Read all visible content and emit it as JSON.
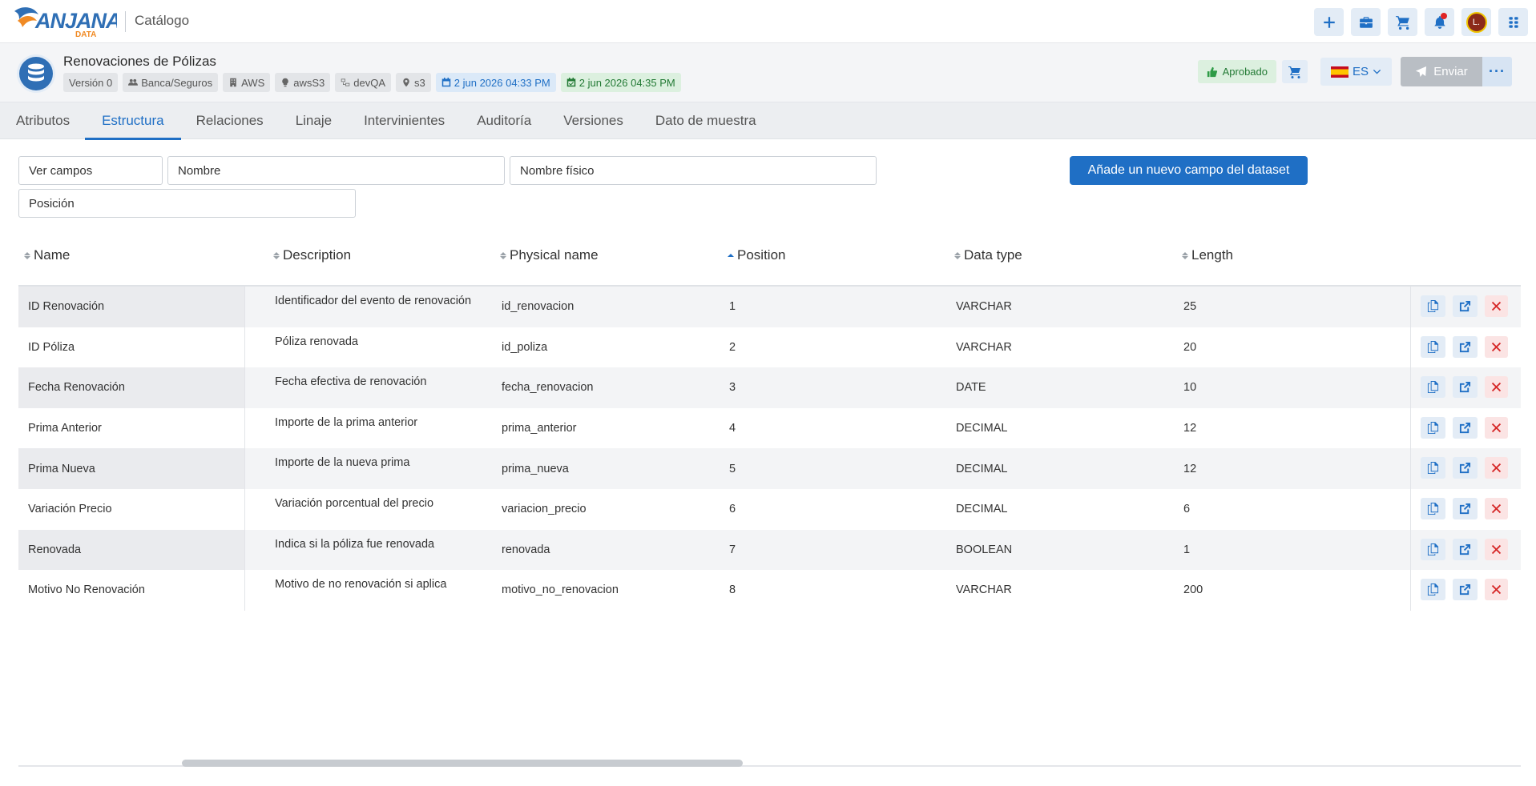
{
  "app": {
    "logo_text": "ANJANA DATA",
    "section_title": "Catálogo",
    "avatar_initial": "L."
  },
  "dataset": {
    "title": "Renovaciones de Pólizas",
    "tags": {
      "version": "Versión 0",
      "domain": "Banca/Seguros",
      "provider": "AWS",
      "source": "awsS3",
      "environment": "devQA",
      "location": "s3",
      "created": "2 jun 2026 04:33 PM",
      "updated": "2 jun 2026 04:35 PM"
    },
    "status": "Aprobado",
    "language": "ES",
    "send_label": "Enviar",
    "more_label": "···"
  },
  "tabs": [
    "Atributos",
    "Estructura",
    "Relaciones",
    "Linaje",
    "Intervinientes",
    "Auditoría",
    "Versiones",
    "Dato de muestra"
  ],
  "active_tab": "Estructura",
  "filters": {
    "ver_campos": "Ver campos",
    "nombre": "Nombre",
    "nombre_fisico": "Nombre físico",
    "posicion": "Posición"
  },
  "add_button_label": "Añade un nuevo campo del dataset",
  "table": {
    "columns": [
      "Name",
      "Description",
      "Physical name",
      "Position",
      "Data type",
      "Length"
    ],
    "sorted_column": "Position",
    "rows": [
      {
        "name": "ID Renovación",
        "description": "Identificador del evento de renovación",
        "physical": "id_renovacion",
        "position": "1",
        "type": "VARCHAR",
        "length": "25"
      },
      {
        "name": "ID Póliza",
        "description": "Póliza renovada",
        "physical": "id_poliza",
        "position": "2",
        "type": "VARCHAR",
        "length": "20"
      },
      {
        "name": "Fecha Renovación",
        "description": "Fecha efectiva de renovación",
        "physical": "fecha_renovacion",
        "position": "3",
        "type": "DATE",
        "length": "10"
      },
      {
        "name": "Prima Anterior",
        "description": "Importe de la prima anterior",
        "physical": "prima_anterior",
        "position": "4",
        "type": "DECIMAL",
        "length": "12"
      },
      {
        "name": "Prima Nueva",
        "description": "Importe de la nueva prima",
        "physical": "prima_nueva",
        "position": "5",
        "type": "DECIMAL",
        "length": "12"
      },
      {
        "name": "Variación Precio",
        "description": "Variación porcentual del precio",
        "physical": "variacion_precio",
        "position": "6",
        "type": "DECIMAL",
        "length": "6"
      },
      {
        "name": "Renovada",
        "description": "Indica si la póliza fue renovada",
        "physical": "renovada",
        "position": "7",
        "type": "BOOLEAN",
        "length": "1"
      },
      {
        "name": "Motivo No Renovación",
        "description": "Motivo de no renovación si aplica",
        "physical": "motivo_no_renovacion",
        "position": "8",
        "type": "VARCHAR",
        "length": "200"
      }
    ]
  },
  "colors": {
    "accent": "#1f6fc5",
    "approved": "#237a35",
    "danger": "#d62828"
  }
}
